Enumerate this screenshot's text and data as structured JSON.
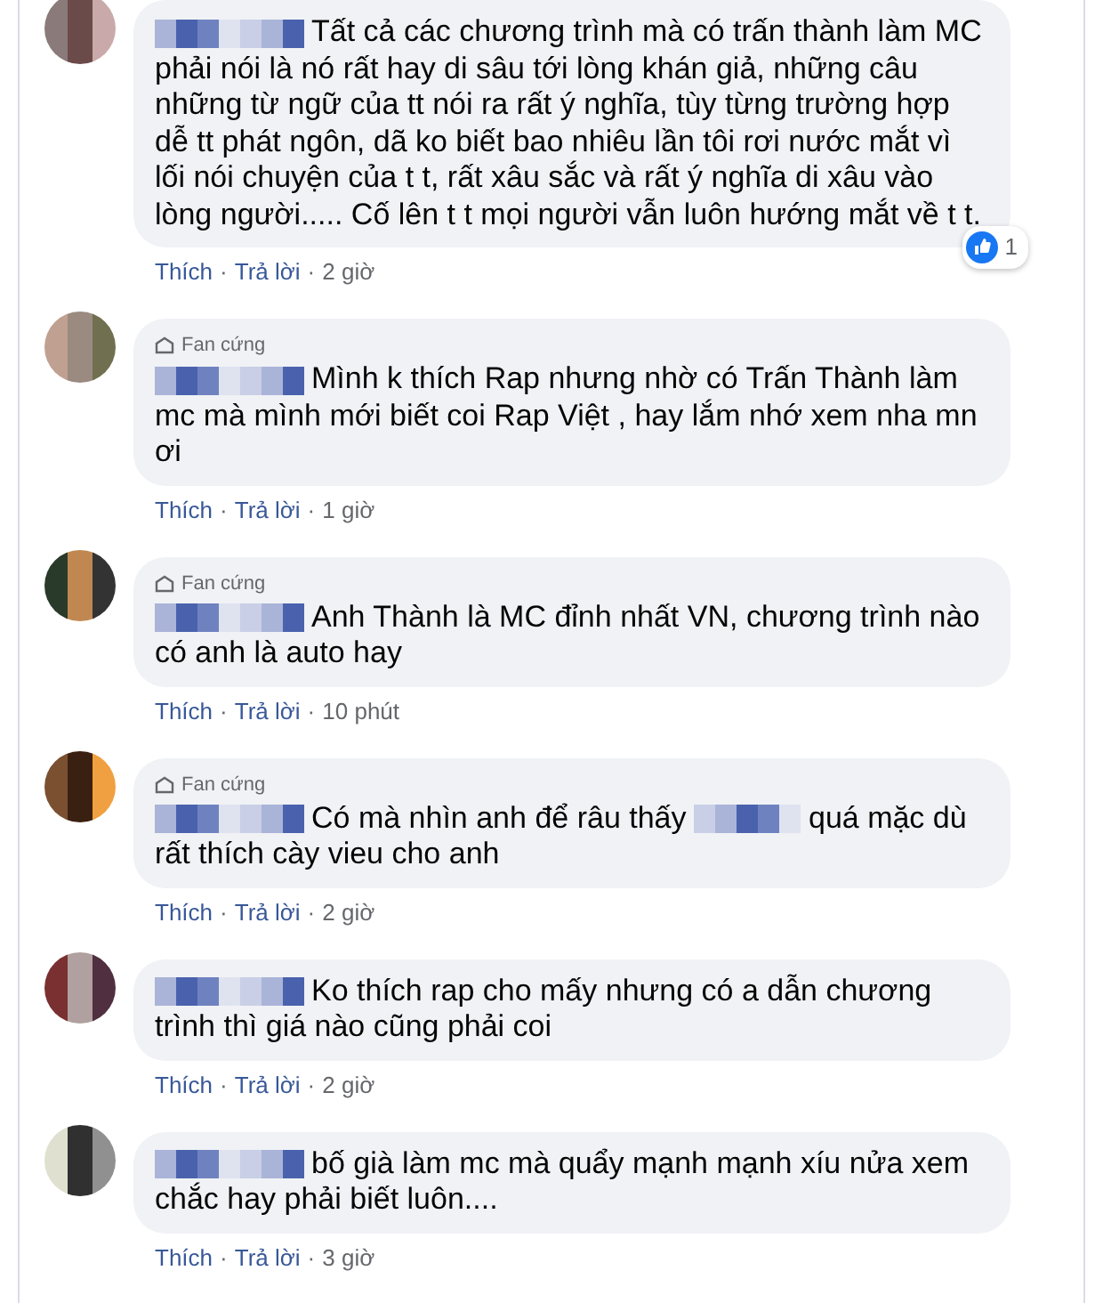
{
  "comments": [
    {
      "segments": [
        {
          "kind": "redacted"
        },
        {
          "kind": "text",
          "text": "Tất cả các chương trình mà có trấn thành làm MC phải nói là nó rất hay di sâu tới lòng khán giả, những câu những từ ngữ của tt nói ra rất ý nghĩa, tùy từng trường hợp dễ tt phát ngôn, dã ko biết bao nhiêu lần tôi rơi nước mắt vì lối nói chuyện của t t, rất xâu sắc và rất ý nghĩa di xâu vào lòng người..... Cố lên t t mọi người vẫn luôn hướng mắt về t t."
        }
      ],
      "actions": {
        "like": "Thích",
        "separator": "·",
        "reply": "Trả lời",
        "time": "2 giờ"
      },
      "reactions": {
        "count": "1"
      }
    },
    {
      "badge": "Fan cứng",
      "segments": [
        {
          "kind": "redacted"
        },
        {
          "kind": "text",
          "text": "Mình k thích Rap nhưng nhờ có Trấn Thành làm mc mà mình mới biết coi Rap Việt , hay lắm nhớ xem nha mn ơi"
        }
      ],
      "actions": {
        "like": "Thích",
        "separator": "·",
        "reply": "Trả lời",
        "time": "1 giờ"
      }
    },
    {
      "badge": "Fan cứng",
      "segments": [
        {
          "kind": "redacted"
        },
        {
          "kind": "text",
          "text": "Anh Thành là MC đỉnh nhất VN, chương trình nào có anh là auto hay"
        }
      ],
      "actions": {
        "like": "Thích",
        "separator": "·",
        "reply": "Trả lời",
        "time": "10 phút"
      }
    },
    {
      "badge": "Fan cứng",
      "segments": [
        {
          "kind": "redacted"
        },
        {
          "kind": "text",
          "text": "Có mà nhìn anh để râu thấy"
        },
        {
          "kind": "redacted"
        },
        {
          "kind": "text",
          "text": "quá mặc dù rất thích cày vieu cho anh"
        }
      ],
      "actions": {
        "like": "Thích",
        "separator": "·",
        "reply": "Trả lời",
        "time": "2 giờ"
      }
    },
    {
      "segments": [
        {
          "kind": "redacted"
        },
        {
          "kind": "text",
          "text": "Ko thích rap cho mấy nhưng có a dẫn chương trình thì giá nào cũng phải coi"
        }
      ],
      "actions": {
        "like": "Thích",
        "separator": "·",
        "reply": "Trả lời",
        "time": "2 giờ"
      }
    },
    {
      "segments": [
        {
          "kind": "redacted"
        },
        {
          "kind": "text",
          "text": "bố già làm mc mà quẩy mạnh mạnh xíu nửa xem chắc hay phải biết luôn...."
        }
      ],
      "actions": {
        "like": "Thích",
        "separator": "·",
        "reply": "Trả lời",
        "time": "3 giờ"
      }
    }
  ]
}
